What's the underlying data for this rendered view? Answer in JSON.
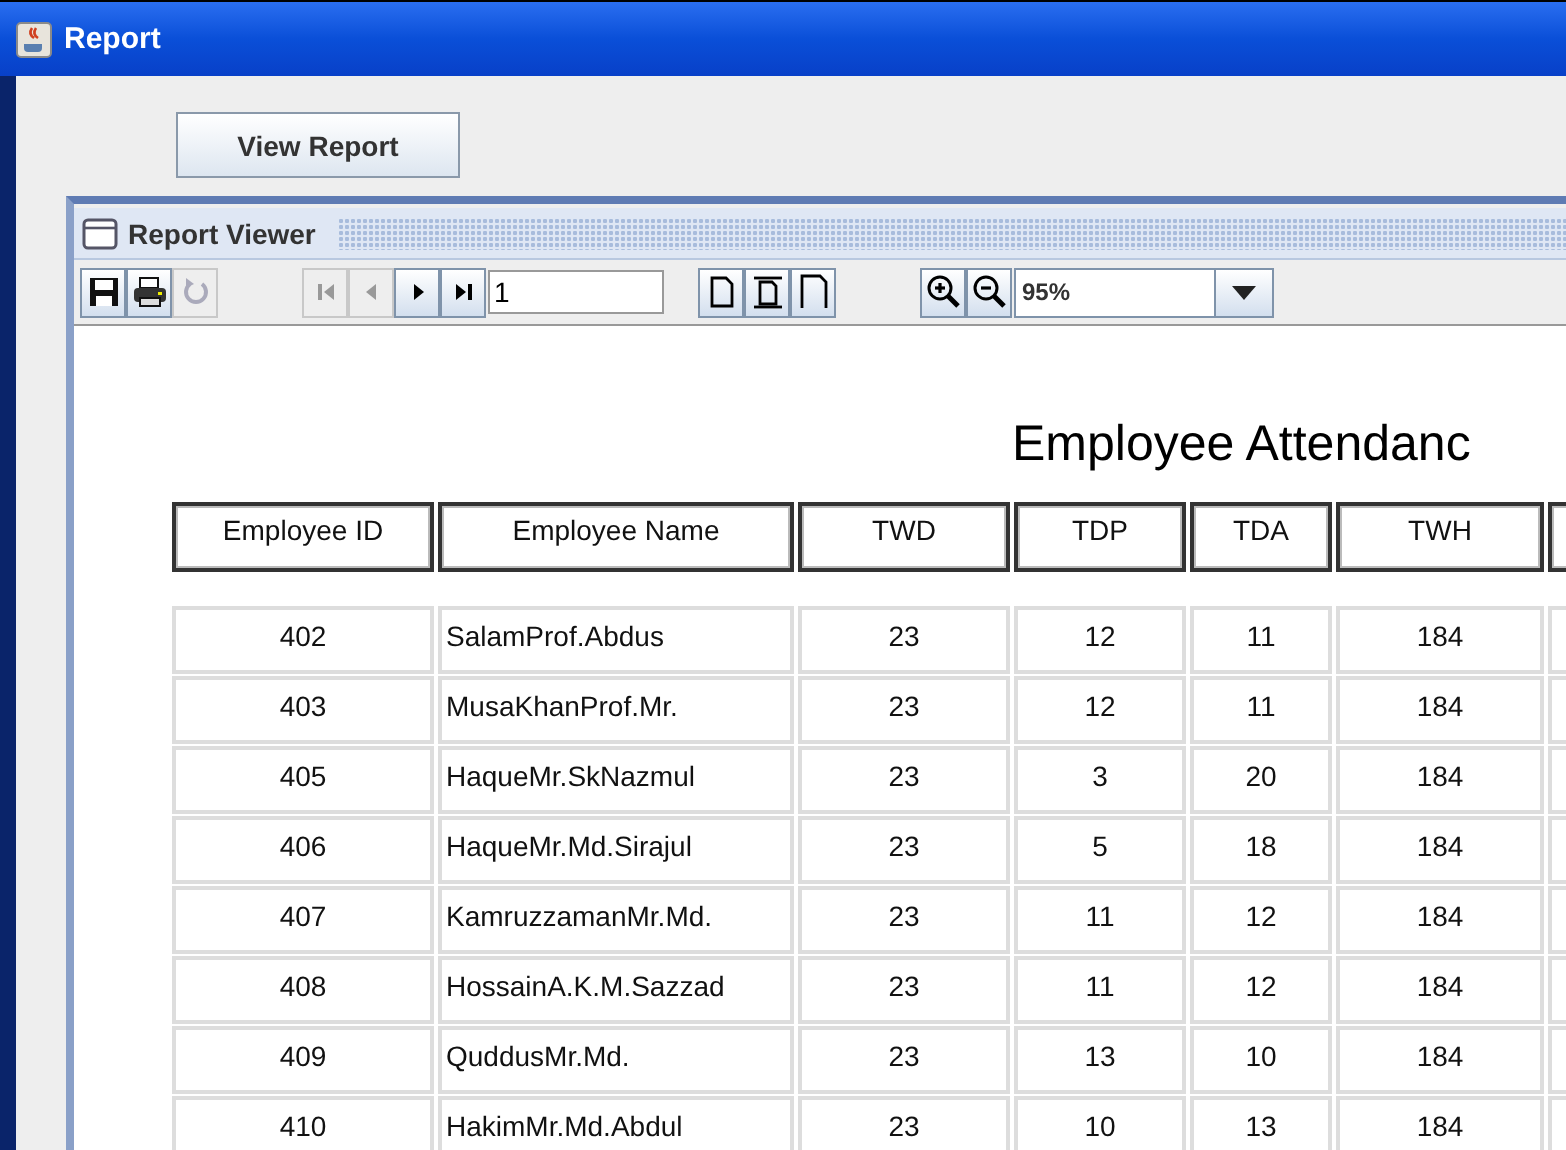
{
  "window": {
    "title": "Report"
  },
  "view_report_button": "View Report",
  "viewer": {
    "title": "Report Viewer",
    "toolbar": {
      "file_buttons": [
        {
          "kind": "save",
          "disabled": false
        },
        {
          "kind": "print",
          "disabled": false
        },
        {
          "kind": "refresh",
          "disabled": true
        }
      ],
      "nav_buttons": [
        {
          "kind": "first",
          "disabled": true
        },
        {
          "kind": "previous",
          "disabled": true
        },
        {
          "kind": "next",
          "disabled": false
        },
        {
          "kind": "last",
          "disabled": false
        }
      ],
      "page_number": "1",
      "page_buttons": [
        {
          "kind": "actual-size",
          "disabled": false
        },
        {
          "kind": "fit-width",
          "disabled": false
        },
        {
          "kind": "fit-page",
          "disabled": false
        }
      ],
      "zoom_buttons": [
        {
          "kind": "zoom-in",
          "disabled": false
        },
        {
          "kind": "zoom-out",
          "disabled": false
        }
      ],
      "zoom": "95%"
    }
  },
  "report": {
    "title": "Employee Attendanc",
    "columns": [
      "Employee ID",
      "Employee Name",
      "TWD",
      "TDP",
      "TDA",
      "TWH"
    ],
    "rows": [
      [
        "402",
        "SalamProf.Abdus",
        "23",
        "12",
        "11",
        "184"
      ],
      [
        "403",
        "MusaKhanProf.Mr.",
        "23",
        "12",
        "11",
        "184"
      ],
      [
        "405",
        "HaqueMr.SkNazmul",
        "23",
        "3",
        "20",
        "184"
      ],
      [
        "406",
        "HaqueMr.Md.Sirajul",
        "23",
        "5",
        "18",
        "184"
      ],
      [
        "407",
        "KamruzzamanMr.Md.",
        "23",
        "11",
        "12",
        "184"
      ],
      [
        "408",
        "HossainA.K.M.Sazzad",
        "23",
        "11",
        "12",
        "184"
      ],
      [
        "409",
        "QuddusMr.Md.",
        "23",
        "13",
        "10",
        "184"
      ],
      [
        "410",
        "HakimMr.Md.Abdul",
        "23",
        "10",
        "13",
        "184"
      ]
    ]
  }
}
